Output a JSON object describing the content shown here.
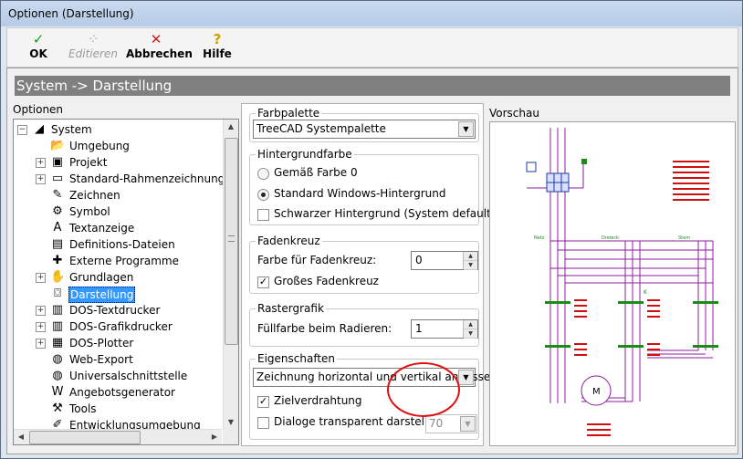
{
  "window": {
    "title": "Optionen (Darstellung)"
  },
  "toolbar": {
    "ok": {
      "label": "OK",
      "icon": "check-icon"
    },
    "edit": {
      "label": "Editieren",
      "icon": "edit-icon"
    },
    "cancel": {
      "label": "Abbrechen",
      "icon": "cross-icon"
    },
    "help": {
      "label": "Hilfe",
      "icon": "help-icon"
    }
  },
  "header": {
    "title": "System -> Darstellung"
  },
  "sidebar": {
    "label": "Optionen",
    "items": [
      {
        "label": "System",
        "icon": "system-icon",
        "expanded": true
      },
      {
        "label": "Umgebung",
        "icon": "folder-open-icon"
      },
      {
        "label": "Projekt",
        "icon": "project-icon"
      },
      {
        "label": "Standard-Rahmenzeichnungen",
        "icon": "monitor-icon"
      },
      {
        "label": "Zeichnen",
        "icon": "draw-icon"
      },
      {
        "label": "Symbol",
        "icon": "symbol-icon"
      },
      {
        "label": "Textanzeige",
        "icon": "text-icon"
      },
      {
        "label": "Definitions-Dateien",
        "icon": "file-icon"
      },
      {
        "label": "Externe Programme",
        "icon": "arrows-icon"
      },
      {
        "label": "Grundlagen",
        "icon": "hand-icon"
      },
      {
        "label": "Darstellung",
        "icon": "display-icon",
        "selected": true
      },
      {
        "label": "DOS-Textdrucker",
        "icon": "printer-icon"
      },
      {
        "label": "DOS-Grafikdrucker",
        "icon": "printer-icon"
      },
      {
        "label": "DOS-Plotter",
        "icon": "plotter-icon"
      },
      {
        "label": "Web-Export",
        "icon": "globe-icon"
      },
      {
        "label": "Universalschnittstelle",
        "icon": "globe-icon"
      },
      {
        "label": "Angebotsgenerator",
        "icon": "word-icon"
      },
      {
        "label": "Tools",
        "icon": "tools-icon"
      },
      {
        "label": "Entwicklungsumgebung",
        "icon": "dev-icon"
      }
    ]
  },
  "farbpalette": {
    "legend": "Farbpalette",
    "selected": "TreeCAD Systempalette"
  },
  "hintergrund": {
    "legend": "Hintergrundfarbe",
    "opt1": "Gemäß Farbe 0",
    "opt2": "Standard Windows-Hintergrund",
    "opt3": "Schwarzer Hintergrund (System default)",
    "selected_index": 2
  },
  "fadenkreuz": {
    "legend": "Fadenkreuz",
    "label": "Farbe für Fadenkreuz:",
    "value": "0",
    "check_label": "Großes Fadenkreuz",
    "checked": true
  },
  "rastergrafik": {
    "legend": "Rastergrafik",
    "label": "Füllfarbe beim Radieren:",
    "value": "1"
  },
  "eigenschaften": {
    "legend": "Eigenschaften",
    "selected": "Zeichnung horizontal und vertikal anpassen",
    "check1": "Zielverdrahtung",
    "check1_checked": true,
    "check2": "Dialoge transparent darstellen",
    "check2_checked": false,
    "transparency": "70"
  },
  "vorschau": {
    "label": "Vorschau",
    "texts": {
      "netz": "Netz",
      "dreieck": "Dreieck",
      "stern": "Stern",
      "motor": "M",
      "k": "K"
    }
  },
  "colors": {
    "header": "#808080",
    "selection": "#3399ff",
    "schematic_line": "#8c1c9e",
    "schematic_text": "#d01010",
    "schematic_green": "#1a8a1a",
    "annotation": "#e01010"
  }
}
